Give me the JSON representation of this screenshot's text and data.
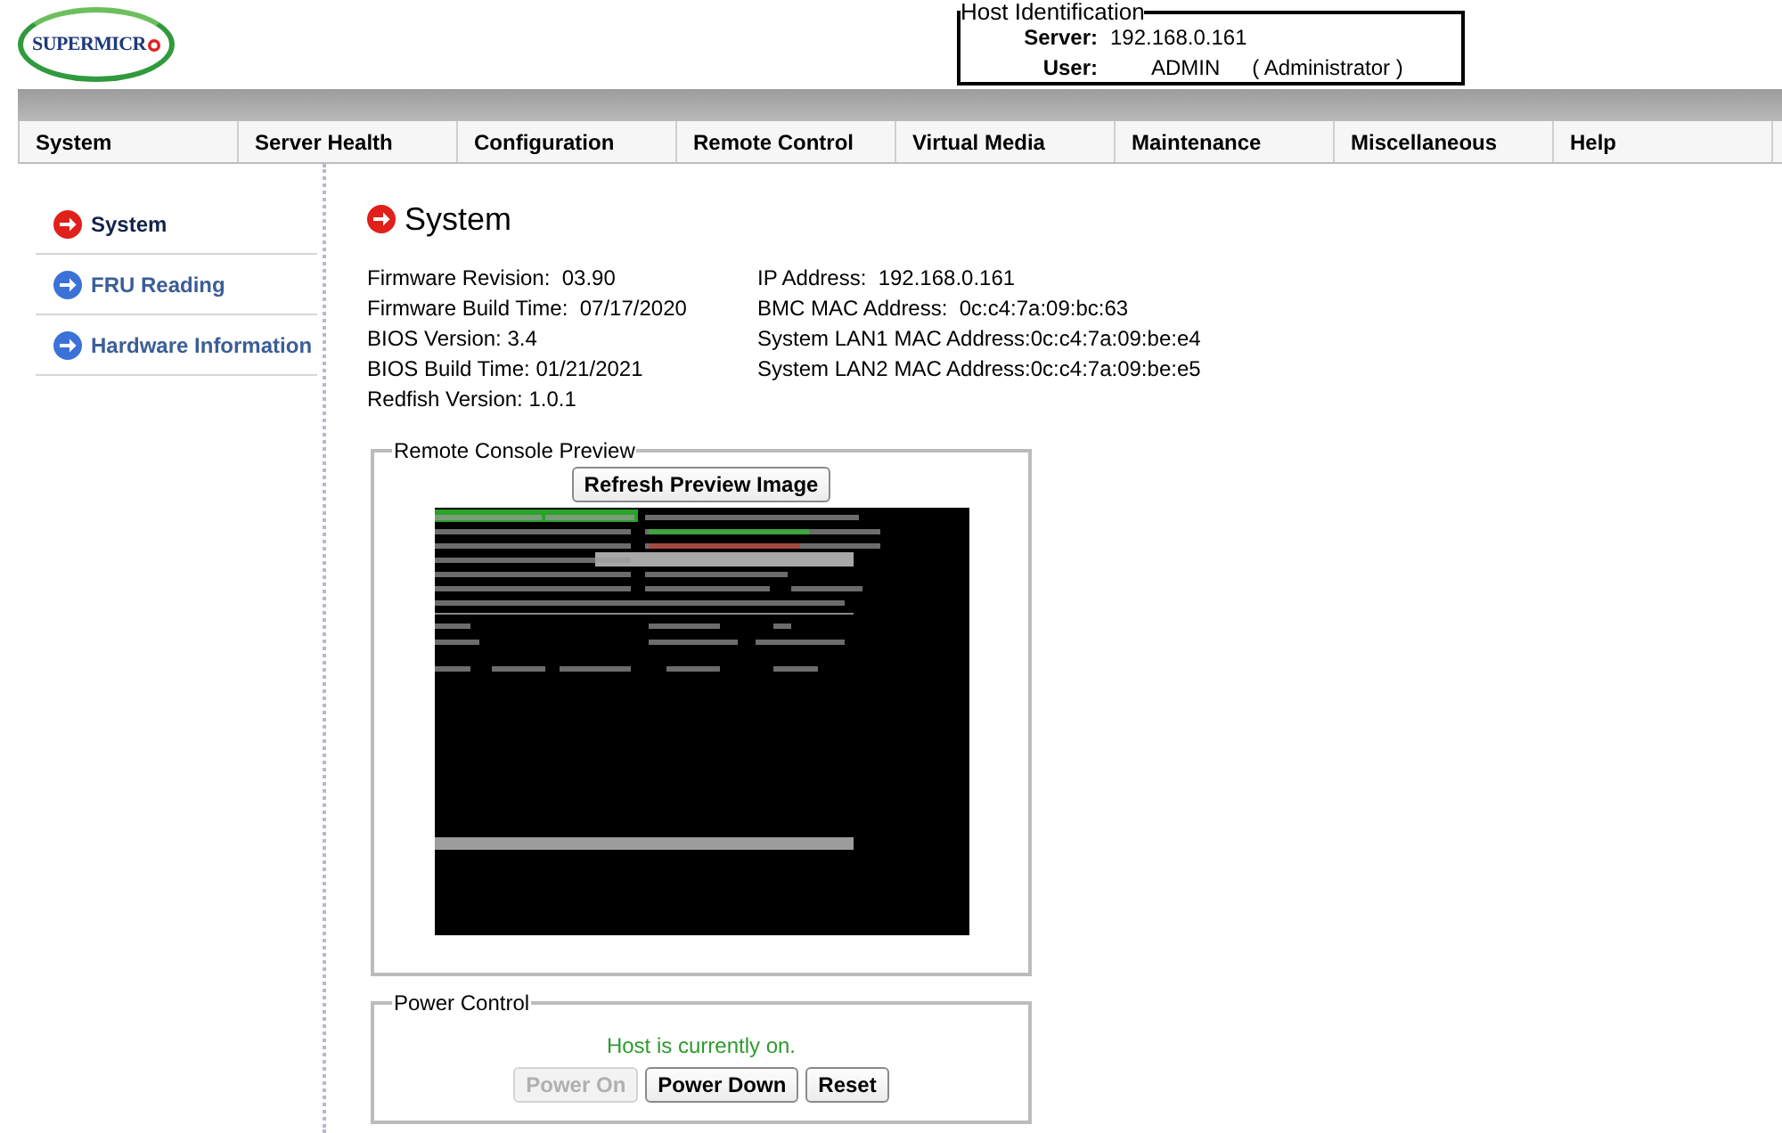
{
  "logo": {
    "text": "SUPERMICR"
  },
  "host_identification": {
    "title": "Host Identification",
    "server_label": "Server:",
    "server": "192.168.0.161",
    "user_label": "User:",
    "user": "ADMIN",
    "role": "( Administrator )"
  },
  "menu": [
    {
      "label": "System"
    },
    {
      "label": "Server Health"
    },
    {
      "label": "Configuration"
    },
    {
      "label": "Remote Control"
    },
    {
      "label": "Virtual Media"
    },
    {
      "label": "Maintenance"
    },
    {
      "label": "Miscellaneous"
    },
    {
      "label": "Help"
    }
  ],
  "sidebar": {
    "items": [
      {
        "label": "System",
        "selected": true
      },
      {
        "label": "FRU Reading",
        "selected": false
      },
      {
        "label": "Hardware Information",
        "selected": false
      }
    ]
  },
  "page": {
    "title": "System",
    "info_left": [
      "Firmware Revision:  03.90",
      "Firmware Build Time:  07/17/2020",
      "BIOS Version: 3.4",
      "BIOS Build Time: 01/21/2021",
      "Redfish Version: 1.0.1"
    ],
    "info_right": [
      "IP Address:  192.168.0.161",
      "BMC MAC Address:  0c:c4:7a:09:bc:63",
      "System LAN1 MAC Address:0c:c4:7a:09:be:e4",
      "System LAN2 MAC Address:0c:c4:7a:09:be:e5"
    ]
  },
  "remote_console": {
    "title": "Remote Console Preview",
    "refresh_button": "Refresh Preview Image"
  },
  "power_control": {
    "title": "Power Control",
    "status": "Host is currently on.",
    "buttons": [
      {
        "label": "Power On",
        "disabled": true
      },
      {
        "label": "Power Down",
        "disabled": false
      },
      {
        "label": "Reset",
        "disabled": false
      }
    ]
  }
}
